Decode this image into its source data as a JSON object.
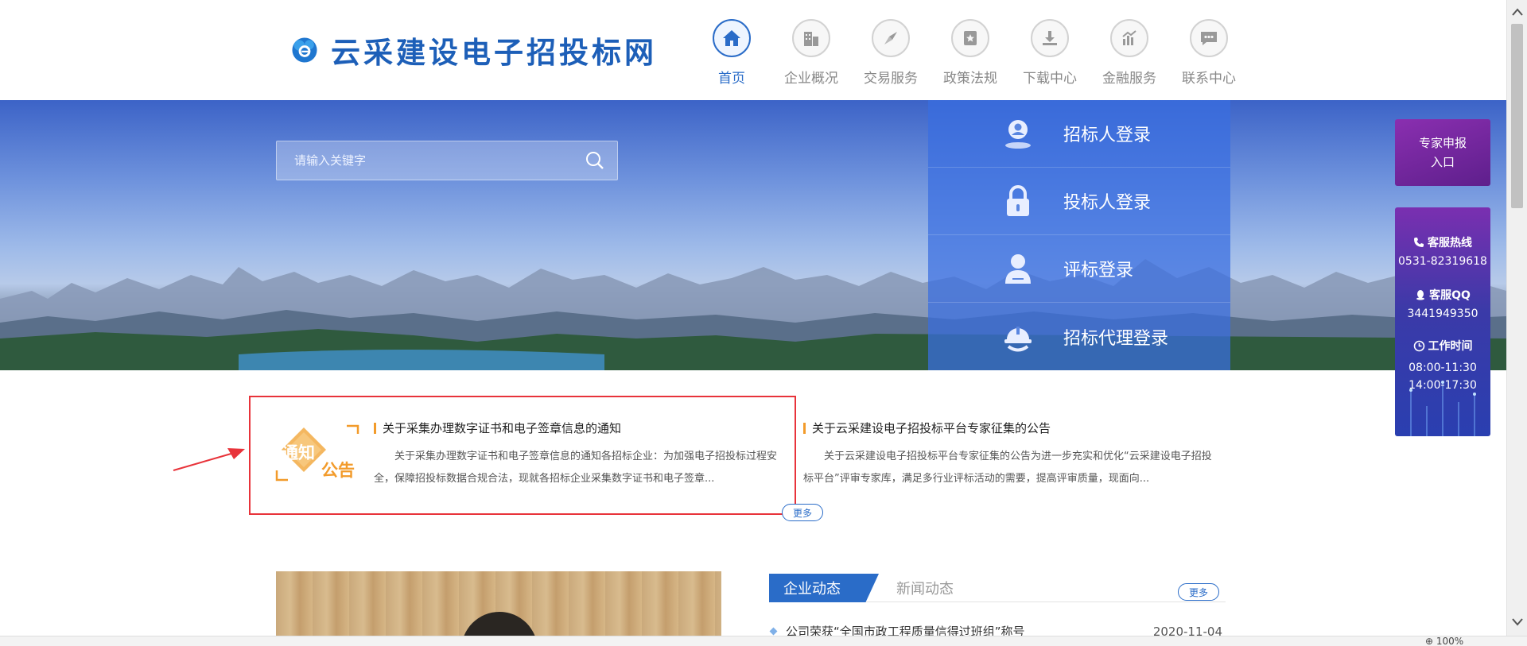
{
  "site": {
    "name": "云采建设电子招投标网"
  },
  "nav": {
    "items": [
      {
        "label": "首页",
        "icon": "home-icon",
        "active": true
      },
      {
        "label": "企业概况",
        "icon": "building-icon",
        "active": false
      },
      {
        "label": "交易服务",
        "icon": "compass-icon",
        "active": false
      },
      {
        "label": "政策法规",
        "icon": "star-badge-icon",
        "active": false
      },
      {
        "label": "下载中心",
        "icon": "download-icon",
        "active": false
      },
      {
        "label": "金融服务",
        "icon": "bar-chart-icon",
        "active": false
      },
      {
        "label": "联系中心",
        "icon": "chat-icon",
        "active": false
      }
    ]
  },
  "search": {
    "placeholder": "请输入关键字"
  },
  "login": {
    "items": [
      {
        "label": "招标人登录",
        "icon": "location-user-icon"
      },
      {
        "label": "投标人登录",
        "icon": "lock-icon"
      },
      {
        "label": "评标登录",
        "icon": "user-icon"
      },
      {
        "label": "招标代理登录",
        "icon": "helmet-icon"
      }
    ]
  },
  "sidebar": {
    "expert": {
      "line1": "专家申报",
      "line2": "入口"
    },
    "hotline": {
      "title": "客服热线",
      "value": "0531-82319618"
    },
    "qq": {
      "title": "客服QQ",
      "value": "3441949350"
    },
    "hours": {
      "title": "工作时间",
      "value1": "08:00-11:30",
      "value2": "14:00-17:30"
    }
  },
  "notice": {
    "badge_top": "通知",
    "badge_bottom": "公告",
    "more": "更多",
    "items": [
      {
        "title": "关于采集办理数字证书和电子签章信息的通知",
        "body": "关于采集办理数字证书和电子签章信息的通知各招标企业：为加强电子招投标过程安全，保障招投标数据合规合法，现就各招标企业采集数字证书和电子签章..."
      },
      {
        "title": "关于云采建设电子招投标平台专家征集的公告",
        "body": "关于云采建设电子招投标平台专家征集的公告为进一步充实和优化“云采建设电子招投标平台”评审专家库，满足多行业评标活动的需要，提高评审质量，现面向..."
      }
    ]
  },
  "news": {
    "tab_active": "企业动态",
    "tab_inactive": "新闻动态",
    "more": "更多",
    "items": [
      {
        "title": "公司荣获“全国市政工程质量信得过班组”称号",
        "date": "2020-11-04"
      }
    ]
  },
  "status": {
    "zoom": "100%"
  },
  "colors": {
    "brand": "#2a6cc8",
    "highlight": "#e8333a",
    "accent": "#f29b2b"
  }
}
